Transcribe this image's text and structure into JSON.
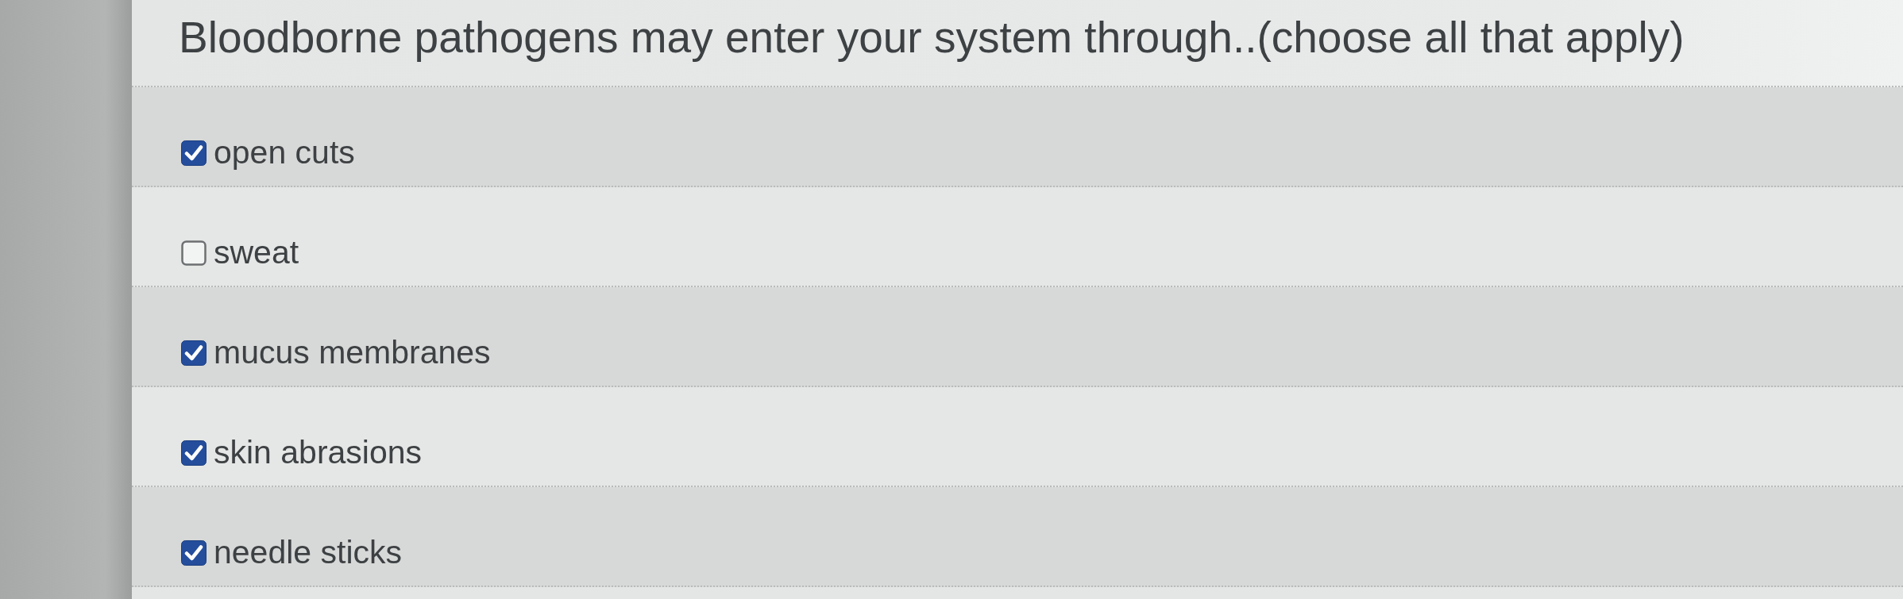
{
  "question": {
    "text": "Bloodborne pathogens may enter your system through..(choose all that apply)"
  },
  "options": [
    {
      "label": "open cuts",
      "checked": true
    },
    {
      "label": "sweat",
      "checked": false
    },
    {
      "label": "mucus membranes",
      "checked": true
    },
    {
      "label": "skin abrasions",
      "checked": true
    },
    {
      "label": "needle sticks",
      "checked": true
    }
  ]
}
